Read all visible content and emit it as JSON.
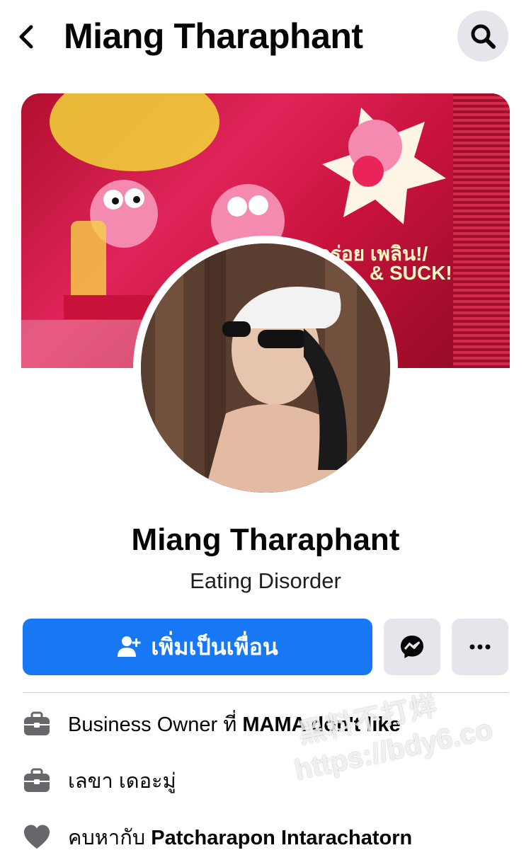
{
  "topbar": {
    "title": "Miang Tharaphant",
    "back_icon": "chevron-left-icon",
    "search_icon": "search-icon"
  },
  "cover": {
    "text_line1": "อร่อย เพลิน!/",
    "text_line2": "& SUCK!"
  },
  "profile": {
    "name": "Miang Tharaphant",
    "subtitle": "Eating Disorder"
  },
  "actions": {
    "add_friend_label": "เพิ่มเป็นเพื่อน",
    "add_friend_icon": "add-user-icon",
    "message_icon": "messenger-icon",
    "more_icon": "more-dots-icon",
    "accent_color": "#1877f2"
  },
  "info": [
    {
      "icon": "briefcase-icon",
      "prefix": "Business Owner ที่ ",
      "bold": "MAMA don't like"
    },
    {
      "icon": "briefcase-icon",
      "prefix": "เลขา เดอะมู่",
      "bold": ""
    },
    {
      "icon": "heart-icon",
      "prefix": "คบหากับ ",
      "bold": "Patcharapon Intarachatorn"
    }
  ],
  "watermark": {
    "line1": "黑料不打烊",
    "line2": "https://bdy6.co"
  }
}
